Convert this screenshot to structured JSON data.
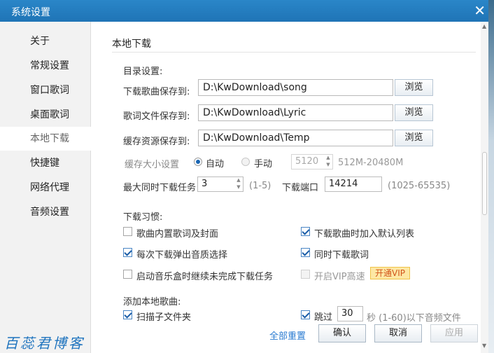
{
  "window": {
    "title": "系统设置",
    "close_glyph": "✕"
  },
  "sidebar": {
    "items": [
      {
        "label": "关于"
      },
      {
        "label": "常规设置"
      },
      {
        "label": "窗口歌词"
      },
      {
        "label": "桌面歌词"
      },
      {
        "label": "本地下载",
        "active": true
      },
      {
        "label": "快捷键"
      },
      {
        "label": "网络代理"
      },
      {
        "label": "音频设置"
      }
    ],
    "watermark": "百蕊君博客"
  },
  "main": {
    "section_title": "本地下载",
    "directory": {
      "heading": "目录设置:",
      "rows": [
        {
          "label": "下载歌曲保存到:",
          "value": "D:\\KwDownload\\song",
          "button": "浏览"
        },
        {
          "label": "歌词文件保存到:",
          "value": "D:\\KwDownload\\Lyric",
          "button": "浏览"
        },
        {
          "label": "缓存资源保存到:",
          "value": "D:\\KwDownload\\Temp",
          "button": "浏览"
        }
      ]
    },
    "cache": {
      "label": "缓存大小设置",
      "auto_label": "自动",
      "manual_label": "手动",
      "selected": "自动",
      "size_value": "5120",
      "range_hint": "512M-20480M"
    },
    "concurrency": {
      "label": "最大同时下载任务",
      "value": "3",
      "range_hint": "(1-5)"
    },
    "port": {
      "label": "下载端口",
      "value": "14214",
      "range_hint": "(1025-65535)"
    },
    "habits": {
      "heading": "下载习惯:",
      "options": [
        {
          "label": "歌曲内置歌词及封面",
          "checked": false
        },
        {
          "label": "下载歌曲时加入默认列表",
          "checked": true
        },
        {
          "label": "每次下载弹出音质选择",
          "checked": true
        },
        {
          "label": "同时下载歌词",
          "checked": true
        },
        {
          "label": "启动音乐盒时继续未完成下载任务",
          "checked": false
        },
        {
          "label": "开启VIP高速",
          "checked": false,
          "disabled": true
        }
      ],
      "vip_button": "开通VIP"
    },
    "local_add": {
      "heading": "添加本地歌曲:",
      "scan_label": "扫描子文件夹",
      "scan_checked": true,
      "skip_label": "跳过",
      "skip_checked": true,
      "skip_value": "30",
      "skip_suffix": "秒 (1-60)以下音频文件"
    }
  },
  "footer": {
    "reset": "全部重置",
    "ok": "确认",
    "cancel": "取消",
    "apply": "应用"
  }
}
